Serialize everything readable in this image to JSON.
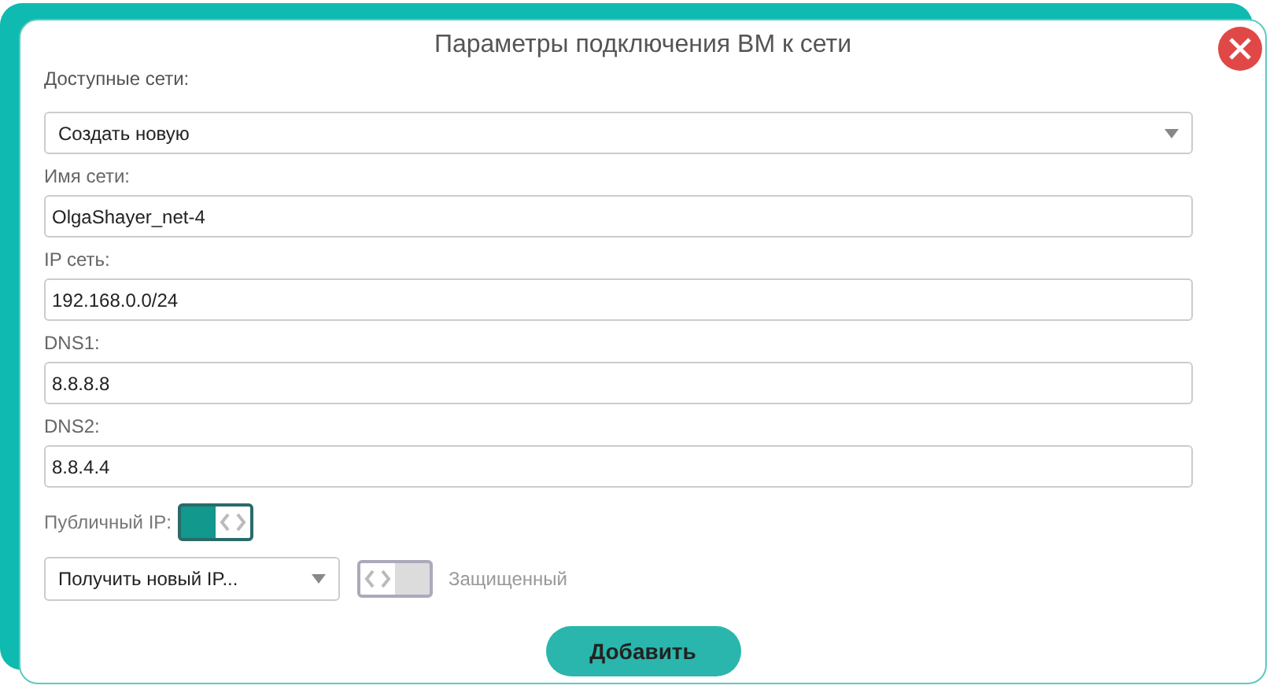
{
  "dialog": {
    "title": "Параметры подключения ВМ к сети"
  },
  "network_select": {
    "label": "Доступные сети:",
    "value": "Создать новую"
  },
  "fields": [
    {
      "label": "Имя сети:",
      "value": "OlgaShayer_net-4"
    },
    {
      "label": "IP сеть:",
      "value": "192.168.0.0/24"
    },
    {
      "label": "DNS1:",
      "value": "8.8.8.8"
    },
    {
      "label": "DNS2:",
      "value": "8.8.4.4"
    }
  ],
  "public_ip": {
    "label": "Публичный IP:",
    "on": true
  },
  "ip_select": {
    "value": "Получить новый IP..."
  },
  "protected": {
    "label": "Защищенный",
    "on": false
  },
  "submit_button": "Добавить"
}
